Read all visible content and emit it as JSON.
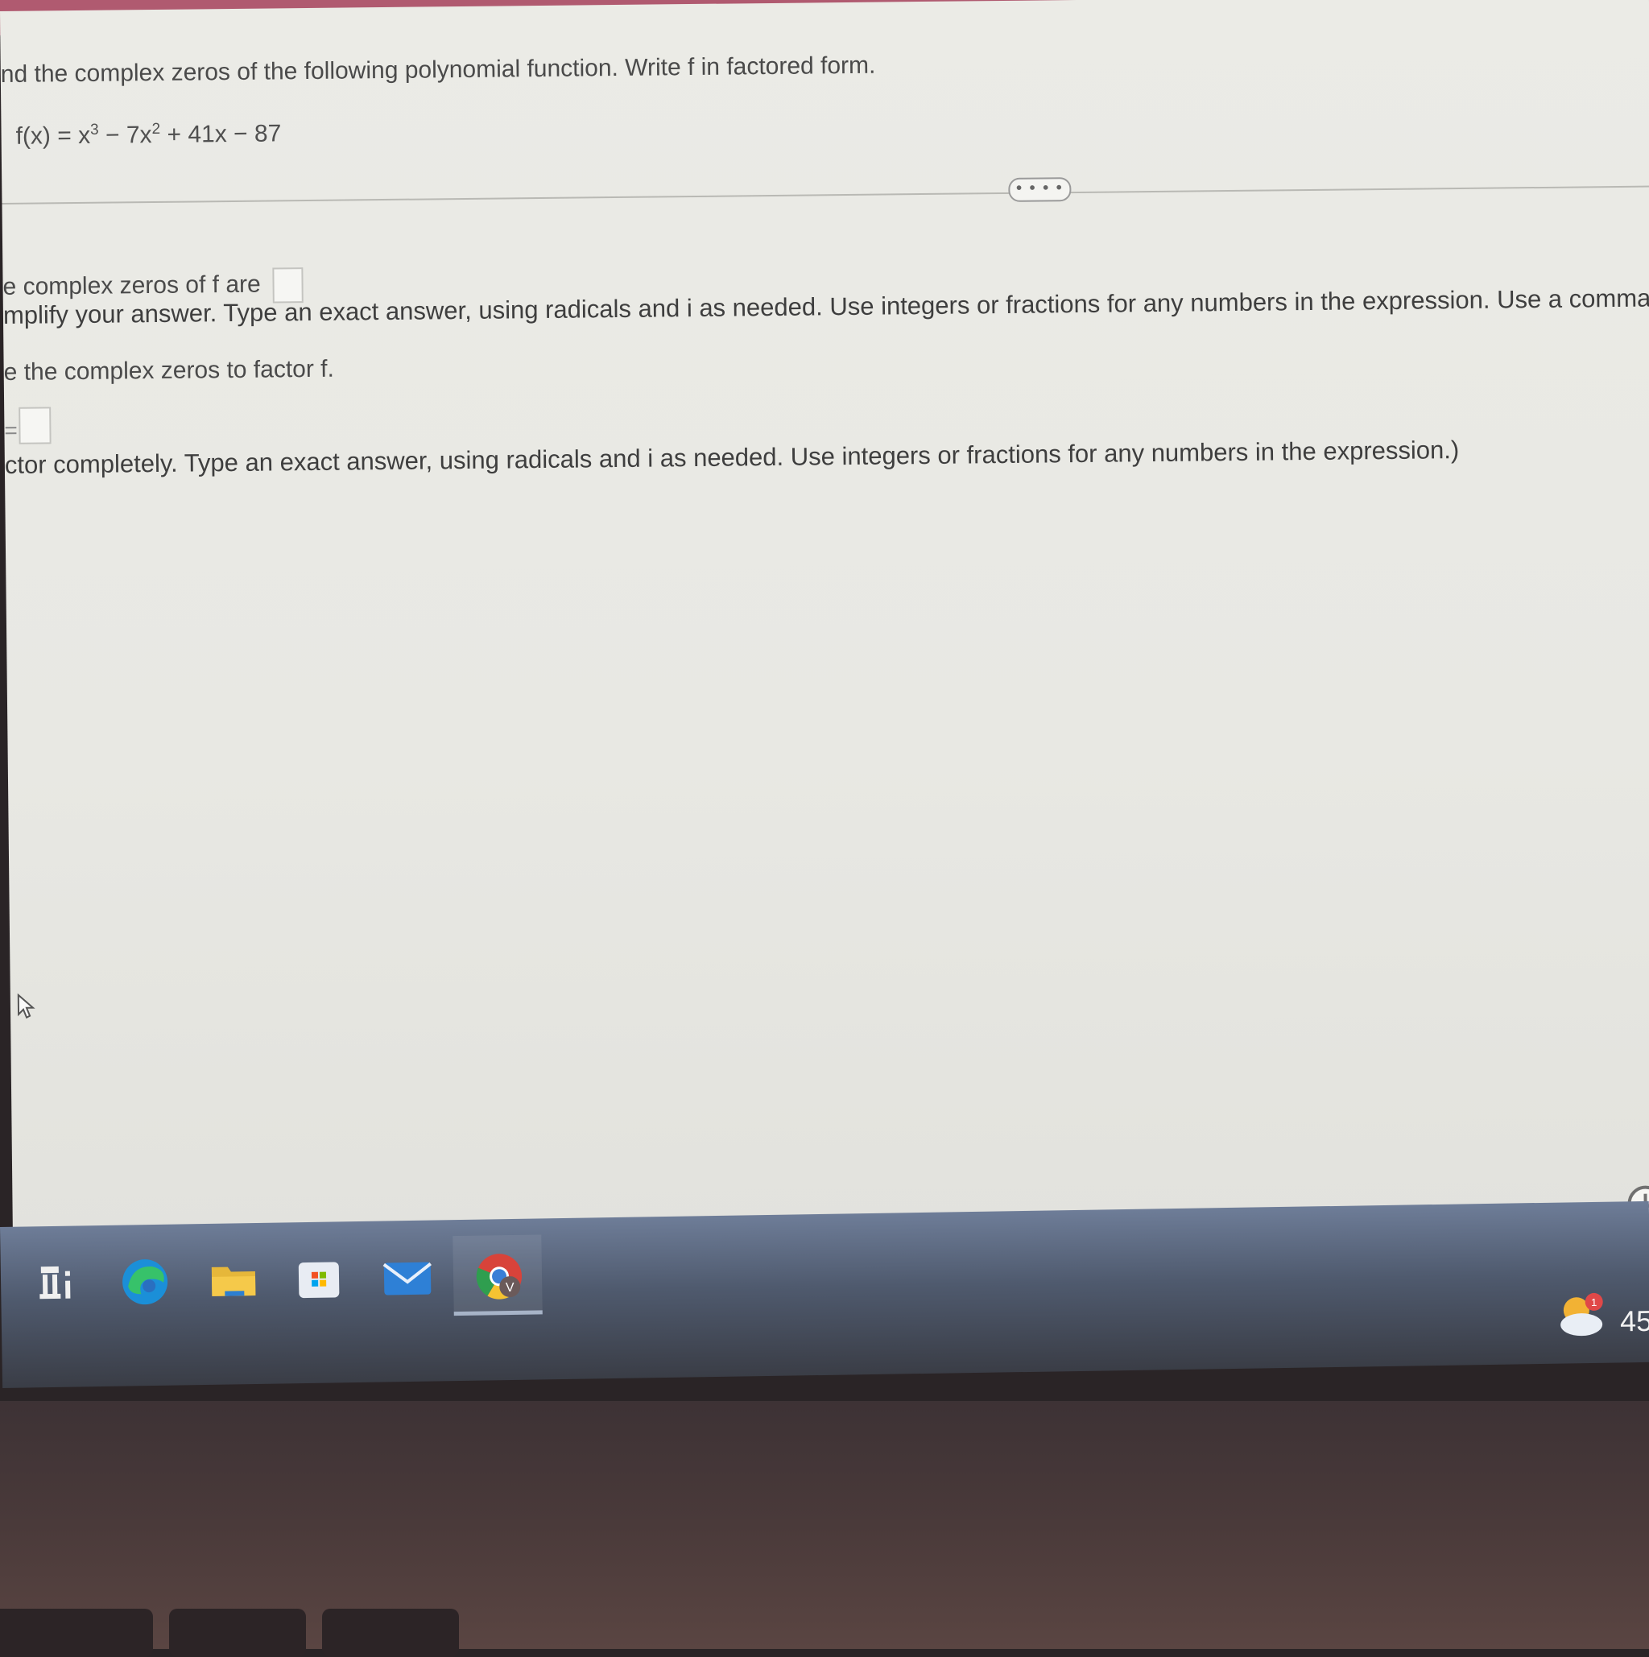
{
  "question": {
    "instruction": "nd the complex zeros of the following polynomial function. Write f in factored form.",
    "equation": {
      "lhs": "f(x) = x",
      "exp1": "3",
      "mid1": " − 7x",
      "exp2": "2",
      "rest": " + 41x − 87"
    },
    "more_label": "• • • •"
  },
  "part_a": {
    "label": "e complex zeros of f are",
    "hint": "mplify your answer. Type an exact answer, using radicals and i as needed. Use integers or fractions for any numbers in the expression. Use a comma to se"
  },
  "part_b": {
    "label": "e the complex zeros to factor f.",
    "eq_prefix": "=",
    "hint": "ctor completely. Type an exact answer, using radicals and i as needed. Use integers or fractions for any numbers in the expression.)"
  },
  "taskbar": {
    "icons": [
      "task-view-icon",
      "edge-icon",
      "file-explorer-icon",
      "store-icon",
      "mail-icon",
      "chrome-icon"
    ],
    "chrome_badge": "V",
    "tray_time": "45",
    "weather_badge": "1"
  },
  "colors": {
    "screen_bg": "#ebebe6",
    "top_bar": "#b05a70",
    "taskbar": "#4f5a6e"
  }
}
